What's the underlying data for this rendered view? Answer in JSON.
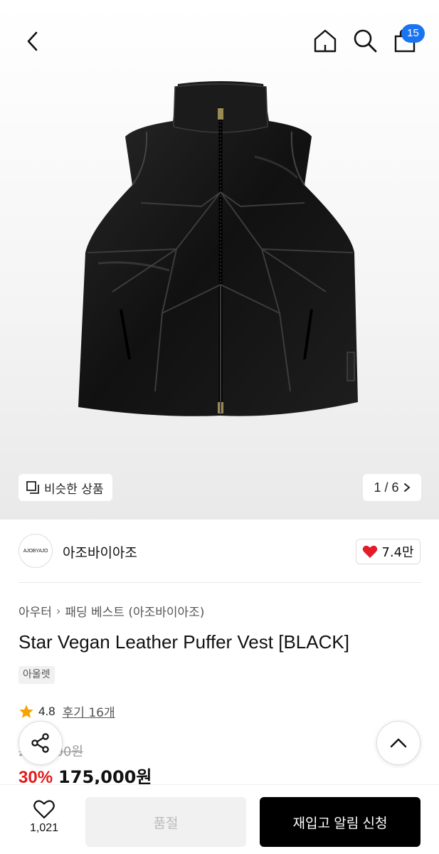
{
  "header": {
    "back_icon": "chevron-left-icon",
    "home_icon": "home-icon",
    "search_icon": "search-icon",
    "cart_icon": "shopping-bag-icon",
    "cart_count": "15",
    "badge_color": "#1a73f0"
  },
  "gallery": {
    "similar_label": "비슷한 상품",
    "page_indicator": "1 / 6"
  },
  "brand": {
    "logo_text": "AJOBYAJO",
    "name": "아조바이아조",
    "likes": "7.4만"
  },
  "product": {
    "breadcrumb": [
      "아우터",
      "패딩 베스트 (아조바이아조)"
    ],
    "title": "Star Vegan Leather Puffer Vest [BLACK]",
    "tag": "아울렛",
    "rating": "4.8",
    "review_label": "후기 16개",
    "original_price": "250,000원",
    "discount": "30%",
    "sale_price": "175,000원",
    "discount_color": "#e41b1b"
  },
  "bottom_bar": {
    "wish_count": "1,021",
    "soldout_label": "품절",
    "restock_label": "재입고 알림 신청"
  }
}
